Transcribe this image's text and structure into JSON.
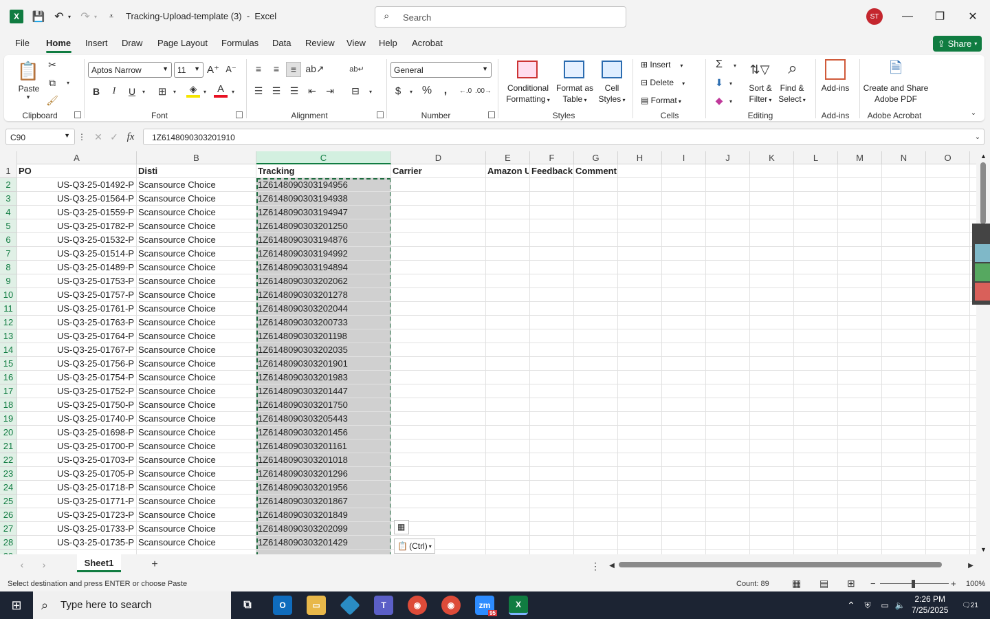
{
  "window": {
    "title": "Tracking-Upload-template (3)",
    "app": "Excel",
    "search_placeholder": "Search",
    "avatar": "ST",
    "minimize": "—",
    "restore": "❐",
    "close": "✕"
  },
  "menu": {
    "items": [
      "File",
      "Home",
      "Insert",
      "Draw",
      "Page Layout",
      "Formulas",
      "Data",
      "Review",
      "View",
      "Help",
      "Acrobat"
    ],
    "share": "Share"
  },
  "ribbon": {
    "clipboard": {
      "paste": "Paste",
      "label": "Clipboard"
    },
    "font": {
      "name": "Aptos Narrow",
      "size": "11",
      "label": "Font"
    },
    "alignment": {
      "label": "Alignment"
    },
    "number": {
      "format": "General",
      "label": "Number",
      "currency": "$",
      "percent": "%"
    },
    "styles": {
      "conditional": [
        "Conditional",
        "Formatting"
      ],
      "format_table": [
        "Format as",
        "Table"
      ],
      "cell_styles": [
        "Cell",
        "Styles"
      ],
      "label": "Styles"
    },
    "cells": {
      "insert": "Insert",
      "delete": "Delete",
      "format": "Format",
      "label": "Cells"
    },
    "editing": {
      "sort": [
        "Sort &",
        "Filter"
      ],
      "find": [
        "Find &",
        "Select"
      ],
      "label": "Editing"
    },
    "addins": {
      "addins": "Add-ins",
      "label": "Add-ins"
    },
    "acrobat": {
      "create": [
        "Create and Share",
        "Adobe PDF"
      ],
      "label": "Adobe Acrobat"
    }
  },
  "formula_bar": {
    "name_box": "C90",
    "fx": "fx",
    "value": "1Z6148090303201910"
  },
  "columns": [
    "A",
    "B",
    "C",
    "D",
    "E",
    "F",
    "G",
    "H",
    "I",
    "J",
    "K",
    "L",
    "M",
    "N",
    "O"
  ],
  "headers": {
    "A": "PO",
    "B": "Disti",
    "C": "Tracking",
    "D": "Carrier",
    "E": "Amazon U",
    "F": "Feedback",
    "G": "Comment"
  },
  "rows": [
    [
      "US-Q3-25-01492-P",
      "Scansource Choice",
      "1Z6148090303194956"
    ],
    [
      "US-Q3-25-01564-P",
      "Scansource Choice",
      "1Z6148090303194938"
    ],
    [
      "US-Q3-25-01559-P",
      "Scansource Choice",
      "1Z6148090303194947"
    ],
    [
      "US-Q3-25-01782-P",
      "Scansource Choice",
      "1Z6148090303201250"
    ],
    [
      "US-Q3-25-01532-P",
      "Scansource Choice",
      "1Z6148090303194876"
    ],
    [
      "US-Q3-25-01514-P",
      "Scansource Choice",
      "1Z6148090303194992"
    ],
    [
      "US-Q3-25-01489-P",
      "Scansource Choice",
      "1Z6148090303194894"
    ],
    [
      "US-Q3-25-01753-P",
      "Scansource Choice",
      "1Z6148090303202062"
    ],
    [
      "US-Q3-25-01757-P",
      "Scansource Choice",
      "1Z6148090303201278"
    ],
    [
      "US-Q3-25-01761-P",
      "Scansource Choice",
      "1Z6148090303202044"
    ],
    [
      "US-Q3-25-01763-P",
      "Scansource Choice",
      "1Z6148090303200733"
    ],
    [
      "US-Q3-25-01764-P",
      "Scansource Choice",
      "1Z6148090303201198"
    ],
    [
      "US-Q3-25-01767-P",
      "Scansource Choice",
      "1Z6148090303202035"
    ],
    [
      "US-Q3-25-01756-P",
      "Scansource Choice",
      "1Z6148090303201901"
    ],
    [
      "US-Q3-25-01754-P",
      "Scansource Choice",
      "1Z6148090303201983"
    ],
    [
      "US-Q3-25-01752-P",
      "Scansource Choice",
      "1Z6148090303201447"
    ],
    [
      "US-Q3-25-01750-P",
      "Scansource Choice",
      "1Z6148090303201750"
    ],
    [
      "US-Q3-25-01740-P",
      "Scansource Choice",
      "1Z6148090303205443"
    ],
    [
      "US-Q3-25-01698-P",
      "Scansource Choice",
      "1Z6148090303201456"
    ],
    [
      "US-Q3-25-01700-P",
      "Scansource Choice",
      "1Z6148090303201161"
    ],
    [
      "US-Q3-25-01703-P",
      "Scansource Choice",
      "1Z6148090303201018"
    ],
    [
      "US-Q3-25-01705-P",
      "Scansource Choice",
      "1Z6148090303201296"
    ],
    [
      "US-Q3-25-01718-P",
      "Scansource Choice",
      "1Z6148090303201956"
    ],
    [
      "US-Q3-25-01771-P",
      "Scansource Choice",
      "1Z6148090303201867"
    ],
    [
      "US-Q3-25-01723-P",
      "Scansource Choice",
      "1Z6148090303201849"
    ],
    [
      "US-Q3-25-01733-P",
      "Scansource Choice",
      "1Z6148090303202099"
    ],
    [
      "US-Q3-25-01735-P",
      "Scansource Choice",
      "1Z6148090303201429"
    ]
  ],
  "paste_options": "(Ctrl)",
  "sheets": {
    "active": "Sheet1",
    "add": "+"
  },
  "status": {
    "message": "Select destination and press ENTER or choose Paste",
    "count": "Count: 89",
    "zoom": "100%"
  },
  "taskbar": {
    "search": "Type here to search",
    "time": "2:26 PM",
    "date": "7/25/2025",
    "notifications": "21",
    "zoom_badge": "95"
  },
  "colors": {
    "accent": "#107c41",
    "selection": "#d0d0d0",
    "avatar": "#c4262e"
  }
}
